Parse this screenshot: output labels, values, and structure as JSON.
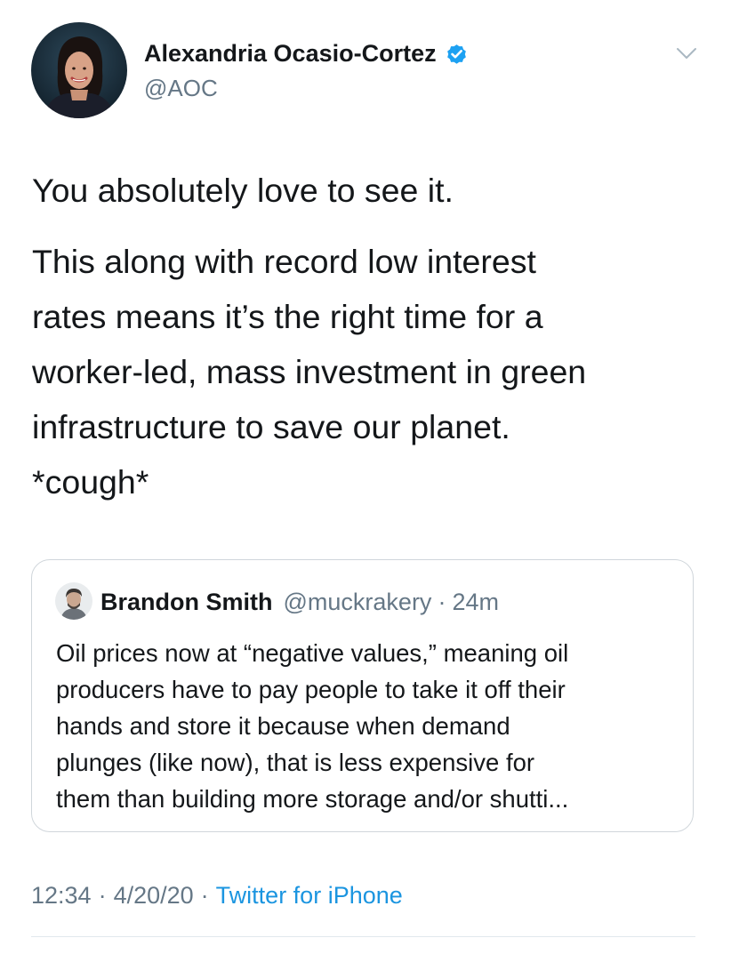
{
  "colors": {
    "text": "#14171a",
    "secondary": "#657786",
    "link": "#1b95e0",
    "verified_badge": "#1da1f2",
    "border": "#d0d6db"
  },
  "tweet": {
    "author": {
      "display_name": "Alexandria Ocasio-Cortez",
      "handle": "@AOC",
      "verified": true,
      "avatar_icon": "avatar-photo"
    },
    "menu_icon": "chevron-down-icon",
    "text_paragraphs": [
      {
        "lines": [
          "You absolutely love to see it."
        ]
      },
      {
        "lines": [
          "This along with record low interest",
          "rates means it’s the right time for a",
          "worker-led, mass investment in green",
          "infrastructure to save our planet.",
          "*cough*"
        ]
      }
    ],
    "quoted_tweet": {
      "author_name": "Brandon Smith",
      "author_handle": "@muckrakery",
      "separator": "·",
      "time": "24m",
      "text_lines": [
        "Oil prices now at “negative values,” meaning oil",
        "producers have to pay people to take it off their",
        "hands and store it because when demand",
        "plunges (like now), that is less expensive for",
        "them than building more storage and/or shutti..."
      ]
    },
    "meta": {
      "time": "12:34",
      "separator": "·",
      "date": "4/20/20",
      "source": "Twitter for iPhone"
    }
  }
}
